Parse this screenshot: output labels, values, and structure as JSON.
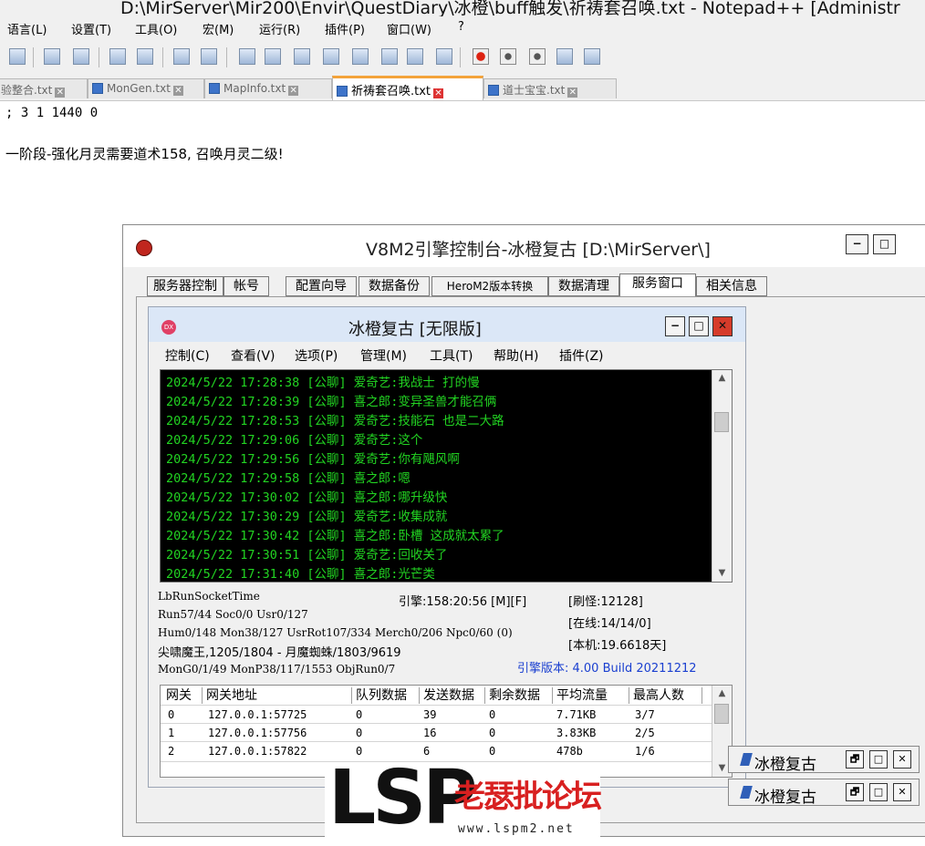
{
  "notepad": {
    "title": "D:\\MirServer\\Mir200\\Envir\\QuestDiary\\冰橙\\buff触发\\祈祷套召唤.txt - Notepad++ [Administr",
    "menu": [
      "语言(L)",
      "设置(T)",
      "工具(O)",
      "宏(M)",
      "运行(R)",
      "插件(P)",
      "窗口(W)",
      "?"
    ],
    "tabs": [
      "验整合.txt",
      "MonGen.txt",
      "MapInfo.txt",
      "祈祷套召唤.txt",
      "道士宝宝.txt"
    ],
    "active_tab": 3,
    "lines": [
      "; 3 1 1440 0",
      "一阶段-强化月灵需要道术158, 召唤月灵二级!"
    ]
  },
  "server": {
    "title": "V8M2引擎控制台-冰橙复古 [D:\\MirServer\\]",
    "min_label": "−",
    "max_label": "□",
    "tabs": [
      "服务器控制",
      "帐号",
      "配置向导",
      "数据备份",
      "HeroM2版本转换",
      "数据清理",
      "服务窗口",
      "相关信息"
    ],
    "active_tab": 6
  },
  "app": {
    "title": "冰橙复古 [无限版]",
    "icon_text": "DX",
    "min_label": "−",
    "max_label": "□",
    "close_label": "✕",
    "menu": [
      "控制(C)",
      "查看(V)",
      "选项(P)",
      "管理(M)",
      "工具(T)",
      "帮助(H)",
      "插件(Z)"
    ],
    "log": [
      "2024/5/22 17:28:38 [公聊] 爱奇艺:我战士  打的慢",
      "2024/5/22 17:28:39 [公聊] 喜之郎:变异圣兽才能召俩",
      "2024/5/22 17:28:53 [公聊] 爱奇艺:技能石 也是二大路",
      "2024/5/22 17:29:06 [公聊] 爱奇艺:这个",
      "2024/5/22 17:29:56 [公聊] 爱奇艺:你有飓风啊",
      "2024/5/22 17:29:58 [公聊] 喜之郎:嗯",
      "2024/5/22 17:30:02 [公聊] 喜之郎:哪升级快",
      "2024/5/22 17:30:29 [公聊] 爱奇艺:收集成就",
      "2024/5/22 17:30:42 [公聊] 喜之郎:卧槽 这成就太累了",
      "2024/5/22 17:30:51 [公聊] 爱奇艺:回收关了",
      "2024/5/22 17:31:40 [公聊] 喜之郎:光芒类"
    ],
    "status": {
      "socket_time": "LbRunSocketTime",
      "run": "Run57/44 Soc0/0 Usr0/127",
      "hum": "Hum0/148 Mon38/127 UsrRot107/334 Merch0/206 Npc0/60 (0)",
      "boss": "尖啸魔王,1205/1804 - 月魔蜘蛛/1803/9619",
      "mong": "MonG0/1/49 MonP38/117/1553 ObjRun0/7",
      "engine": "引擎:158:20:56 [M][F]",
      "refresh": "[刷怪:12128]",
      "online": "[在线:14/14/0]",
      "local": "[本机:19.6618天]",
      "version": "引擎版本: 4.00 Build 20211212"
    },
    "gateway_table": {
      "columns": [
        "网关",
        "网关地址",
        "队列数据",
        "发送数据",
        "剩余数据",
        "平均流量",
        "最高人数"
      ],
      "rows": [
        [
          "0",
          "127.0.0.1:57725",
          "0",
          "39",
          "0",
          "7.71KB",
          "3/7"
        ],
        [
          "1",
          "127.0.0.1:57756",
          "0",
          "16",
          "0",
          "3.83KB",
          "2/5"
        ],
        [
          "2",
          "127.0.0.1:57822",
          "0",
          "6",
          "0",
          "478b",
          "1/6"
        ]
      ]
    }
  },
  "side_windows": [
    {
      "label": "冰橙复古",
      "restore_label": "🗗",
      "max_label": "□",
      "close_label": "✕"
    },
    {
      "label": "冰橙复古",
      "restore_label": "🗗",
      "max_label": "□",
      "close_label": "✕"
    }
  ],
  "watermark": {
    "brand": "LSP",
    "forum": "老瑟批论坛",
    "url": "www.lspm2.net"
  },
  "colors": {
    "log_text": "#22d422",
    "log_bg": "#000000",
    "version_text": "#1a3fd0",
    "tab_accent": "#f3a33a"
  }
}
